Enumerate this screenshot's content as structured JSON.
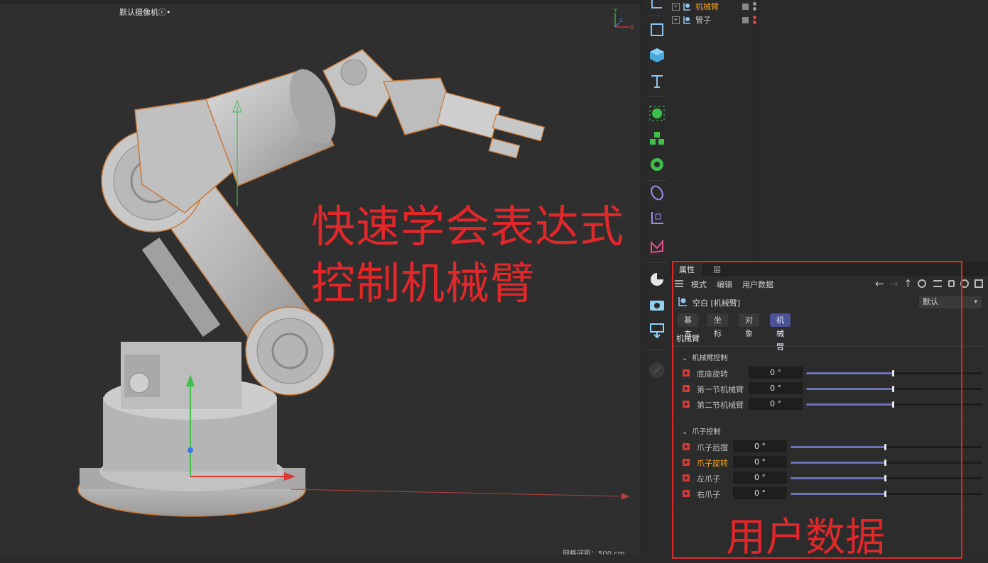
{
  "viewport": {
    "camera_label": "默认摄像机",
    "camera_symbol": "ⓒ•",
    "overlay_line1": "快速学会表达式",
    "overlay_line2": "控制机械臂",
    "grid_label": "网格间距：500 cm",
    "model": "robot-arm"
  },
  "toolbar": {
    "icons": [
      "coordinate-icon",
      "rectangle-icon",
      "cube-icon",
      "text-icon",
      "spline-icon",
      "cloner-icon",
      "gear-icon",
      "deformer-icon",
      "null-axis-icon",
      "mesh-icon",
      "sky-icon",
      "camera-icon",
      "light-icon",
      "disabled-icon"
    ]
  },
  "objects": {
    "rows": [
      {
        "name": "机械臂",
        "color": "#f0a020",
        "dot1": "#9a9a9a",
        "dot2": "#9a9a9a"
      },
      {
        "name": "管子",
        "color": "#cfcfcf",
        "dot1": "#e04040",
        "dot2": "#e04040"
      }
    ]
  },
  "attributes": {
    "tab_props": "属性",
    "tab_layers": "层",
    "menu_mode": "模式",
    "menu_edit": "编辑",
    "menu_userdata": "用户数据",
    "object_line": "空白 [机械臂]",
    "preset": "默认",
    "subtabs": [
      "基本",
      "坐标",
      "对象",
      "机械臂"
    ],
    "section_title": "机械臂",
    "group1_title": "机械臂控制",
    "group1": [
      {
        "label": "底座旋转",
        "value": "0 °",
        "slider": 0.5
      },
      {
        "label": "第一节机械臂",
        "value": "0 °",
        "slider": 0.5
      },
      {
        "label": "第二节机械臂",
        "value": "0 °",
        "slider": 0.5
      }
    ],
    "group2_title": "爪子控制",
    "group2": [
      {
        "label": "爪子后摆",
        "value": "0 °",
        "slider": 0.5
      },
      {
        "label": "爪子旋转",
        "value": "0 °",
        "slider": 0.5,
        "highlight": "#f0a020"
      },
      {
        "label": "左爪子",
        "value": "0 °",
        "slider": 0.5
      },
      {
        "label": "右爪子",
        "value": "0 °",
        "slider": 0.5
      }
    ],
    "big_label": "用户数据"
  }
}
